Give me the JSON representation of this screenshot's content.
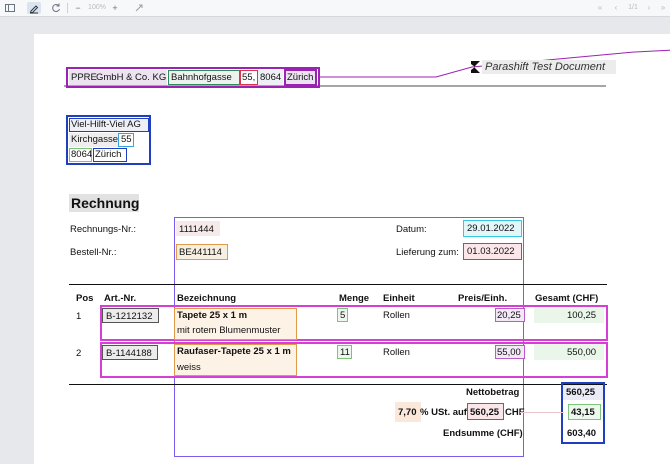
{
  "toolbar": {
    "zoom": "100%",
    "page_indicator": "1/1"
  },
  "document": {
    "sender": {
      "company_a": "PPRE",
      "company_b": "GmbH & Co. KG",
      "street": "Bahnhofgasse",
      "number": "55,",
      "zip": "8064",
      "city": "Zürich"
    },
    "brand_text": "Parashift Test Document",
    "recipient": {
      "name": "Viel-Hilft-Viel AG",
      "street": "Kirchgasse",
      "number": "55",
      "zip": "8064",
      "city": "Zürich"
    },
    "title": "Rechnung",
    "invoice_no_label": "Rechnungs-Nr.:",
    "invoice_no": "1111444",
    "order_no_label": "Bestell-Nr.:",
    "order_no": "BE441114",
    "date_label": "Datum:",
    "date": "29.01.2022",
    "delivery_label": "Lieferung zum:",
    "delivery": "01.03.2022",
    "table": {
      "headers": {
        "pos": "Pos",
        "art": "Art.-Nr.",
        "desc": "Bezeichnung",
        "qty": "Menge",
        "unit": "Einheit",
        "price": "Preis/Einh.",
        "total": "Gesamt (CHF)"
      },
      "rows": [
        {
          "pos": "1",
          "art": "B-1212132",
          "desc1": "Tapete 25 x 1 m",
          "desc2": "mit rotem Blumenmuster",
          "qty": "5",
          "unit": "Rollen",
          "price": "20,25",
          "total": "100,25"
        },
        {
          "pos": "2",
          "art": "B-1144188",
          "desc1": "Raufaser-Tapete 25 x 1 m",
          "desc2": "weiss",
          "qty": "11",
          "unit": "Rollen",
          "price": "55,00",
          "total": "550,00"
        }
      ]
    },
    "net_label": "Nettobetrag",
    "net": "560,25",
    "vat_rate": "7,70",
    "vat_text": "% USt. auf",
    "vat_base": "560,25",
    "vat_currency": "CHF",
    "vat": "43,15",
    "sum_label": "Endsumme (CHF)",
    "sum": "603,40"
  },
  "colors": {
    "purple": "#9b22b3",
    "green": "#7cc47a",
    "blue": "#1f3fbf",
    "red": "#d8364d",
    "cyan": "#38c7e0",
    "orange": "#e09b4a",
    "violet": "#7a5cf0",
    "magenta": "#d63fd6"
  }
}
